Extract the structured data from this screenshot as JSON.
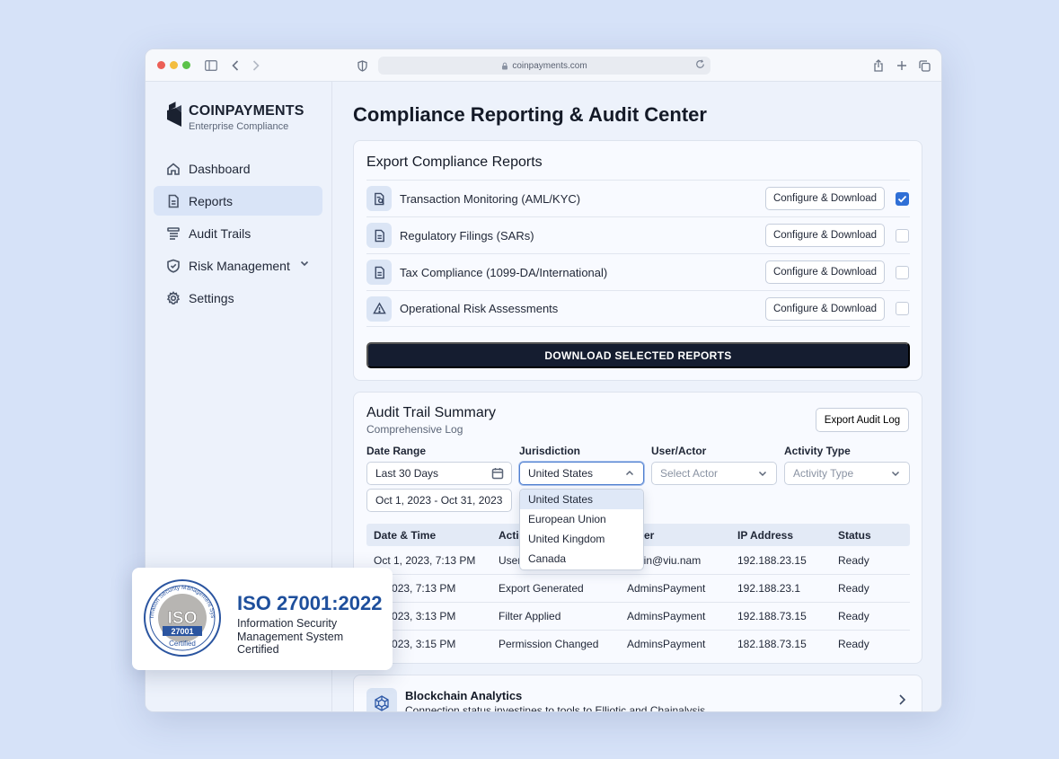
{
  "browser": {
    "url": "coinpayments.com"
  },
  "brand": {
    "name": "COINPAYMENTS",
    "subtitle": "Enterprise Compliance"
  },
  "sidebar": {
    "items": [
      {
        "label": "Dashboard",
        "icon": "home-icon"
      },
      {
        "label": "Reports",
        "icon": "document-icon",
        "active": true
      },
      {
        "label": "Audit Trails",
        "icon": "list-icon"
      },
      {
        "label": "Risk Management",
        "icon": "shield-icon",
        "expandable": true
      },
      {
        "label": "Settings",
        "icon": "gear-icon"
      }
    ]
  },
  "page": {
    "title": "Compliance Reporting & Audit Center"
  },
  "export_reports": {
    "title": "Export Compliance Reports",
    "configure_label": "Configure & Download",
    "reports": [
      {
        "label": "Transaction Monitoring (AML/KYC)",
        "icon": "document-search-icon",
        "checked": true
      },
      {
        "label": "Regulatory Filings (SARs)",
        "icon": "document-icon",
        "checked": false
      },
      {
        "label": "Tax Compliance (1099-DA/International)",
        "icon": "document-icon",
        "checked": false
      },
      {
        "label": "Operational Risk Assessments",
        "icon": "warning-icon",
        "checked": false
      }
    ],
    "download_label": "DOWNLOAD SELECTED REPORTS"
  },
  "audit": {
    "title": "Audit Trail Summary",
    "subtitle": "Comprehensive Log",
    "export_label": "Export Audit Log",
    "filters": {
      "date_range_label": "Date Range",
      "date_range_value": "Last 30 Days",
      "date_range_dates": "Oct 1, 2023 - Oct 31, 2023",
      "jurisdiction_label": "Jurisdiction",
      "jurisdiction_value": "United States",
      "jurisdiction_options": [
        "United States",
        "European Union",
        "United Kingdom",
        "Canada"
      ],
      "user_label": "User/Actor",
      "user_placeholder": "Select Actor",
      "activity_label": "Activity Type",
      "activity_placeholder": "Activity Type"
    },
    "columns": [
      "Date & Time",
      "Actio",
      "er",
      "IP Address",
      "Status"
    ],
    "rows": [
      {
        "date": "Oct 1, 2023, 7:13 PM",
        "action": "User",
        "user": "nin@viu.nam",
        "ip": "192.188.23.15",
        "status": "Ready"
      },
      {
        "date": "1, 2023, 7:13 PM",
        "action": "Export Generated",
        "user": "AdminsPayment",
        "ip": "192.188.23.1",
        "status": "Ready"
      },
      {
        "date": "1, 2023, 3:13 PM",
        "action": "Filter Applied",
        "user": "AdminsPayment",
        "ip": "192.188.73.15",
        "status": "Ready"
      },
      {
        "date": "1, 2023, 3:15 PM",
        "action": "Permission Changed",
        "user": "AdminsPayment",
        "ip": "182.188.73.15",
        "status": "Ready"
      }
    ]
  },
  "blockchain": {
    "title": "Blockchain Analytics",
    "description": "Connection status investines to tools to Elliotic and Chainalysis"
  },
  "iso": {
    "title": "ISO 27001:2022",
    "description": "Information Security Management System Certified",
    "seal_top": "Information Security Management System",
    "seal_main": "ISO",
    "seal_number": "27001",
    "seal_bottom": "Certified"
  }
}
